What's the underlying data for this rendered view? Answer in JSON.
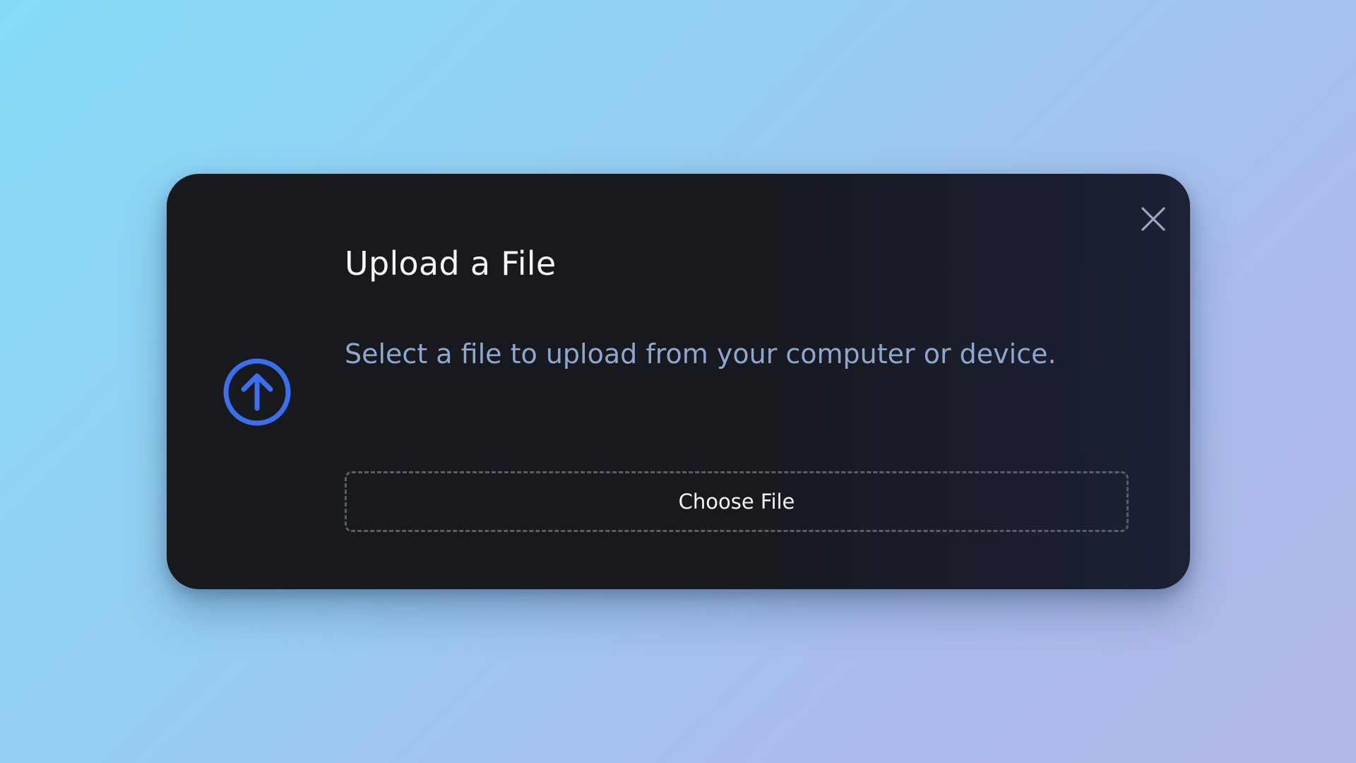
{
  "dialog": {
    "title": "Upload a File",
    "description": "Select a file to upload from your computer or device.",
    "choose_button_label": "Choose File",
    "close_icon": "close-icon",
    "upload_icon": "arrow-up-circle-icon"
  },
  "colors": {
    "accent": "#3a6ff0",
    "modal_background": "#18191d",
    "title_text": "#f3f4f7",
    "description_text": "#8ea7cf",
    "dashed_border": "#5b5d66"
  }
}
